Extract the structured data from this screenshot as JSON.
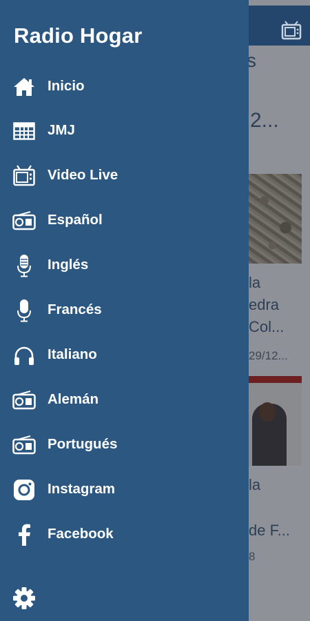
{
  "app": {
    "title": "Radio Hogar"
  },
  "drawer": {
    "items": [
      {
        "label": "Inicio",
        "icon": "home-icon"
      },
      {
        "label": "JMJ",
        "icon": "grid-table-icon"
      },
      {
        "label": "Video Live",
        "icon": "tv-icon"
      },
      {
        "label": "Español",
        "icon": "radio-icon"
      },
      {
        "label": "Inglés",
        "icon": "microphone-icon"
      },
      {
        "label": "Francés",
        "icon": "microphone-icon"
      },
      {
        "label": "Italiano",
        "icon": "headphones-icon"
      },
      {
        "label": "Alemán",
        "icon": "radio-icon"
      },
      {
        "label": "Portugués",
        "icon": "radio-icon"
      },
      {
        "label": "Instagram",
        "icon": "instagram-icon"
      },
      {
        "label": "Facebook",
        "icon": "facebook-icon"
      }
    ],
    "footer_icon": "gear-icon"
  },
  "background": {
    "toolbar_icon": "tv-icon",
    "heading_fragments": [
      "s",
      "2..."
    ],
    "article1": {
      "lines": [
        "la",
        "edra",
        "Col..."
      ],
      "date": "29/12..."
    },
    "article2": {
      "lines": [
        "la",
        "de F..."
      ],
      "date": "8"
    }
  },
  "colors": {
    "drawer": "#2b5781",
    "toolbar": "#24466d",
    "text": "#ffffff"
  }
}
